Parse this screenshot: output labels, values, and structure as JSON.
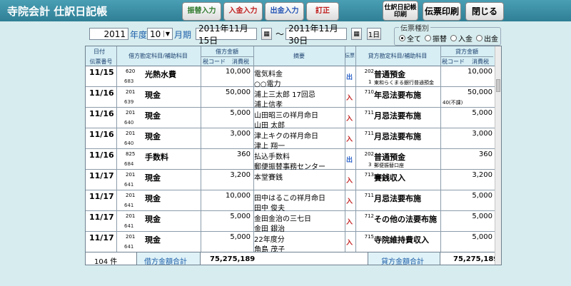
{
  "app": {
    "title": "寺院会計 仕訳日記帳"
  },
  "toolbar": {
    "transfer": "振替入力",
    "receipt": "入金入力",
    "payment": "出金入力",
    "correction": "訂正",
    "journal_print": "仕訳日記帳印刷",
    "slip_print": "伝票印刷",
    "close": "閉じる"
  },
  "filter": {
    "year": "2011",
    "year_label": "年度",
    "month": "10",
    "month_label": "月期",
    "date_from": "2011年11月15日",
    "date_to": "2011年11月30日",
    "range_mark": "〜",
    "one_day": "1日"
  },
  "slip_type": {
    "title": "伝票種別",
    "options": [
      "全て",
      "振替",
      "入金",
      "出金"
    ],
    "selected": "全て"
  },
  "headers": {
    "date": "日付",
    "slip_no": "伝票番号",
    "debit_account": "借方勘定科目/補助科目",
    "debit_amount": "借方金額",
    "tax_code": "税コード",
    "consumption_tax": "消費税",
    "summary": "摘要",
    "kind": "伝票",
    "credit_account": "貸方勘定科目/補助科目",
    "credit_amount": "貸方金額",
    "credit_tax_code": "税コード",
    "credit_consumption_tax": "消費税"
  },
  "rows": [
    {
      "date": "11/15",
      "slip": "683",
      "dcode": "620",
      "dacct": "光熱水費",
      "damt": "10,000",
      "sum1": "電気料金",
      "sum2": "○○電力",
      "kind": "出",
      "ccode": "202",
      "cacct": "普通預金",
      "csub": "1",
      "csub_name": "東和らくまる銀行普通預金",
      "camt": "10,000",
      "ctax": ""
    },
    {
      "date": "11/16",
      "slip": "639",
      "dcode": "201",
      "dacct": "現金",
      "damt": "50,000",
      "sum1": "浦上三太郎 17回忌",
      "sum2": "浦上信孝",
      "kind": "入",
      "ccode": "710",
      "cacct": "年忌法要布施",
      "csub": "",
      "csub_name": "",
      "camt": "50,000",
      "ctax": "40(不課)"
    },
    {
      "date": "11/16",
      "slip": "640",
      "dcode": "201",
      "dacct": "現金",
      "damt": "5,000",
      "sum1": "山田昭三の祥月命日",
      "sum2": "山田 太郎",
      "kind": "入",
      "ccode": "711",
      "cacct": "月忌法要布施",
      "csub": "",
      "csub_name": "",
      "camt": "5,000",
      "ctax": ""
    },
    {
      "date": "11/16",
      "slip": "640",
      "dcode": "201",
      "dacct": "現金",
      "damt": "3,000",
      "sum1": "津上キクの祥月命日",
      "sum2": "津上 翔一",
      "kind": "入",
      "ccode": "711",
      "cacct": "月忌法要布施",
      "csub": "",
      "csub_name": "",
      "camt": "3,000",
      "ctax": ""
    },
    {
      "date": "11/16",
      "slip": "684",
      "dcode": "825",
      "dacct": "手数料",
      "damt": "360",
      "sum1": "払込手数料",
      "sum2": "郵便振替事務センター",
      "kind": "出",
      "ccode": "202",
      "cacct": "普通預金",
      "csub": "3",
      "csub_name": "郵便振替口座",
      "camt": "360",
      "ctax": ""
    },
    {
      "date": "11/17",
      "slip": "641",
      "dcode": "201",
      "dacct": "現金",
      "damt": "3,200",
      "sum1": "本堂賽銭",
      "sum2": "",
      "kind": "入",
      "ccode": "713",
      "cacct": "賽銭収入",
      "csub": "",
      "csub_name": "",
      "camt": "3,200",
      "ctax": ""
    },
    {
      "date": "11/17",
      "slip": "641",
      "dcode": "201",
      "dacct": "現金",
      "damt": "10,000",
      "sum1": "田中はるこの祥月命日",
      "sum2": "田中 俊夫",
      "kind": "入",
      "ccode": "711",
      "cacct": "月忌法要布施",
      "csub": "",
      "csub_name": "",
      "camt": "5,000",
      "ctax": ""
    },
    {
      "date": "11/17",
      "slip": "641",
      "dcode": "201",
      "dacct": "現金",
      "damt": "5,000",
      "sum1": "金田金治の三七日",
      "sum2": "金田 銀治",
      "kind": "入",
      "ccode": "712",
      "cacct": "その他の法要布施",
      "csub": "",
      "csub_name": "",
      "camt": "5,000",
      "ctax": ""
    },
    {
      "date": "11/17",
      "slip": "641",
      "dcode": "201",
      "dacct": "現金",
      "damt": "5,000",
      "sum1": "22年度分",
      "sum2": "角島 茂子",
      "kind": "入",
      "ccode": "715",
      "cacct": "寺院維持費収入",
      "csub": "",
      "csub_name": "",
      "camt": "5,000",
      "ctax": ""
    }
  ],
  "footer": {
    "count": "104 件",
    "debit_total_label": "借方金額合計",
    "debit_total": "75,275,189",
    "credit_total_label": "貸方金額合計",
    "credit_total": "75,275,189"
  }
}
